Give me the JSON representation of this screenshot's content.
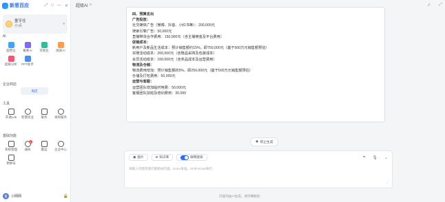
{
  "app": {
    "name": "新思百应",
    "tab_title": "超级AI"
  },
  "window_controls": [
    "⤢",
    "□",
    "—",
    "✕"
  ],
  "user": {
    "name": "董亨佳",
    "sub": "小点"
  },
  "sections": {
    "ai": "AI",
    "enterprise": "企业商店",
    "tools": "工具",
    "basic": "基础功能"
  },
  "ai_items": [
    {
      "label": "面营业",
      "color": "#3fa4ff"
    },
    {
      "label": "概要AI",
      "color": "#7a6cf6"
    },
    {
      "label": "可视化",
      "color": "#2dbf9b"
    },
    {
      "label": "图表AI",
      "color": "#ff9d4a"
    },
    {
      "label": "超级分析",
      "color": "#f0597a"
    },
    {
      "label": "PPT助手",
      "color": "#4b8cf5"
    }
  ],
  "enterprise_button": "商店",
  "tool_items": [
    {
      "label": "开通Lab"
    },
    {
      "label": "智慧商业"
    },
    {
      "label": "服务"
    },
    {
      "label": "采购服务"
    }
  ],
  "basic_items": [
    {
      "label": "系统管理"
    },
    {
      "label": "通知",
      "badge": "1"
    },
    {
      "label": "搬运"
    },
    {
      "label": "企业中心"
    },
    {
      "label": "更换号"
    }
  ],
  "bottom_user": {
    "avatar": "董",
    "name": "小网网"
  },
  "content_lines": [
    {
      "text": "四、预算支出",
      "bold": true
    },
    {
      "text": "广告投放：",
      "bold": true
    },
    {
      "text": "社交媒体广告（微博、抖音、小红书等）：200,000元"
    },
    {
      "text": "搜索引擎广告：50,000元"
    },
    {
      "text": "直播带货合作费用：150,000元（含主播佣金及平台费用）"
    },
    {
      "text": "促销成本：",
      "bold": true
    },
    {
      "text": "新用户及新品生活成本：预计销售额约15%，即750,000元（基于500万元销售额预估）"
    },
    {
      "text": "买赠活动成本：200,000元（含赠品采购及包装成本）"
    },
    {
      "text": "会员活动成本：100,000元（含奖品成本及运营费用）"
    },
    {
      "text": "物流及仓储：",
      "bold": true
    },
    {
      "text": "物流费用增加：预计销售额的5%，即250,000元（基于500万元销售额预估）"
    },
    {
      "text": "仓储及打包费用：50,000元"
    },
    {
      "text": "运营与客服：",
      "bold": true
    },
    {
      "text": "运营团队增加临时用费：50,000元"
    },
    {
      "text": "客服团队加班及培训费用：30,000"
    }
  ],
  "stop_button": "停止生成",
  "input": {
    "tool_image": "图片",
    "tool_knowledge": "知识库",
    "tool_web": "联网搜索",
    "placeholder": "请输入问题或者问题相关内容，Enter发送，Shift+Enter换行",
    "corner": "⋰"
  },
  "footer_note": "内容均由AI生成，请仔细甄别"
}
